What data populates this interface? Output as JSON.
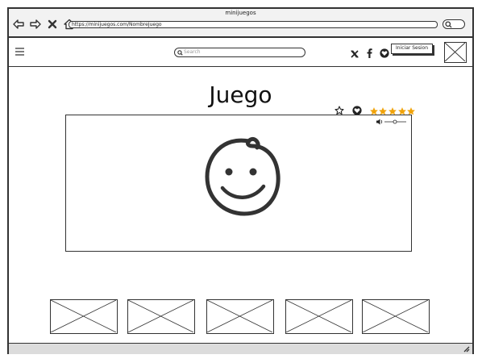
{
  "window": {
    "title": "minijuegos"
  },
  "browser": {
    "url": "https://minijuegos.com/NombreJuego",
    "icons": [
      "back-arrow-icon",
      "forward-arrow-icon",
      "close-icon",
      "home-icon",
      "search-icon"
    ]
  },
  "header": {
    "search_placeholder": "Search",
    "login_label": "Iniciar Sesion",
    "social_icons": [
      "x-logo-icon",
      "facebook-icon",
      "heart-icon"
    ]
  },
  "game": {
    "title": "Juego",
    "rating": 5,
    "rating_max": 5,
    "icons": [
      "favorite-star-icon",
      "like-heart-icon",
      "volume-icon"
    ]
  },
  "thumbnails_count": 5,
  "colors": {
    "rating_star": "#f0a30a",
    "border": "#333333",
    "statusbar": "#dcdcdc"
  }
}
